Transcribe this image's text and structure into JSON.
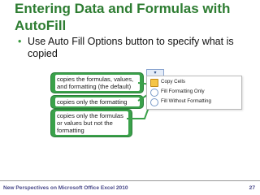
{
  "slide": {
    "title": "Entering Data and Formulas with AutoFill",
    "bullet": "Use Auto Fill Options button to specify what is copied"
  },
  "callouts": [
    "copies the formulas, values, and formatting (the default)",
    "copies only the formatting",
    "copies only the formulas or values but not the formatting"
  ],
  "menu": {
    "button_label": "▾",
    "items": [
      {
        "label": "Copy Cells",
        "selected": true
      },
      {
        "label": "Fill Formatting Only",
        "selected": false
      },
      {
        "label": "Fill Without Formatting",
        "selected": false
      }
    ]
  },
  "footer": {
    "left": "New Perspectives on Microsoft Office Excel 2010",
    "right": "27"
  },
  "colors": {
    "title": "#2e7d32",
    "callout": "#3aa14a"
  }
}
